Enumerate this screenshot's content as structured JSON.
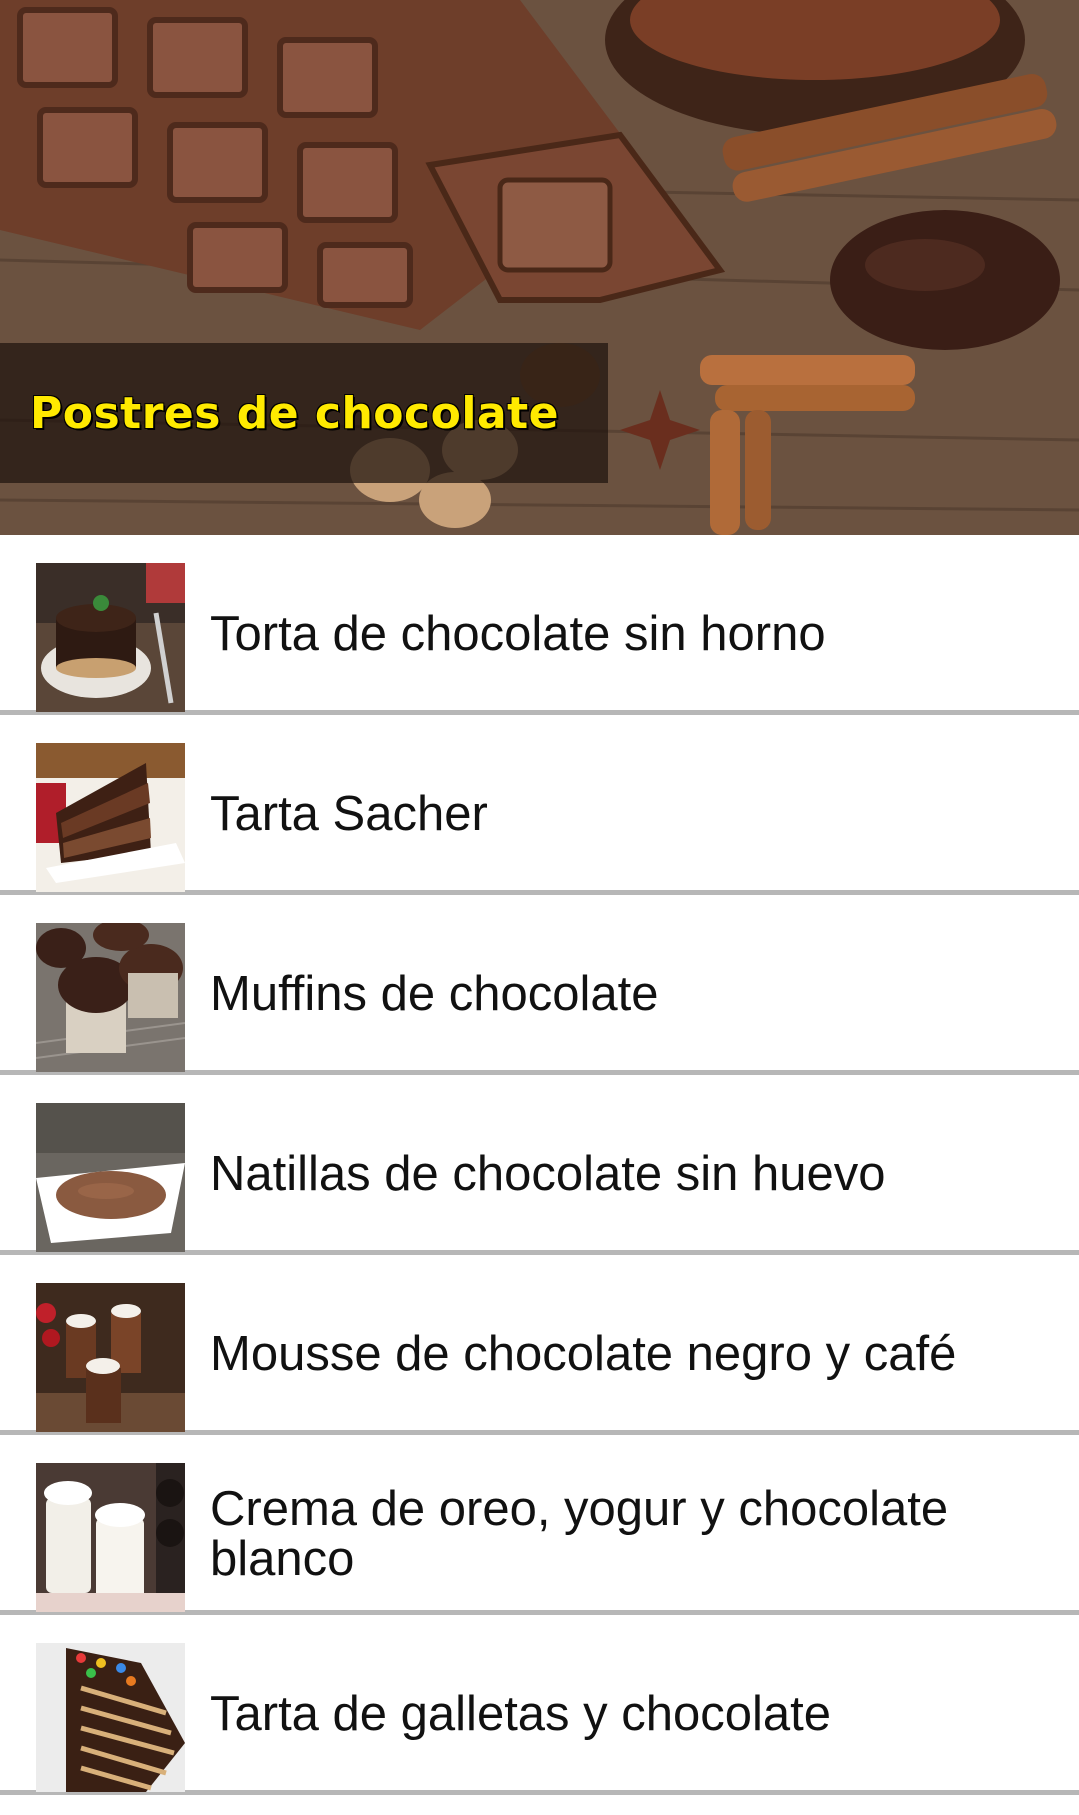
{
  "header": {
    "title": "Postres de chocolate"
  },
  "recipes": [
    {
      "label": "Torta de chocolate sin horno",
      "icon": "cake-on-stand-image"
    },
    {
      "label": "Tarta Sacher",
      "icon": "cake-slice-image"
    },
    {
      "label": "Muffins de chocolate",
      "icon": "muffins-image"
    },
    {
      "label": "Natillas de chocolate sin huevo",
      "icon": "custard-bowl-image"
    },
    {
      "label": "Mousse de chocolate negro y café",
      "icon": "mousse-glasses-image"
    },
    {
      "label": "Crema de oreo, yogur y chocolate blanco",
      "icon": "oreo-cream-cups-image"
    },
    {
      "label": "Tarta de galletas y chocolate",
      "icon": "biscuit-cake-image"
    }
  ],
  "colors": {
    "title_text": "#ffea00",
    "divider": "#b7b7b7",
    "list_text": "#111111"
  }
}
